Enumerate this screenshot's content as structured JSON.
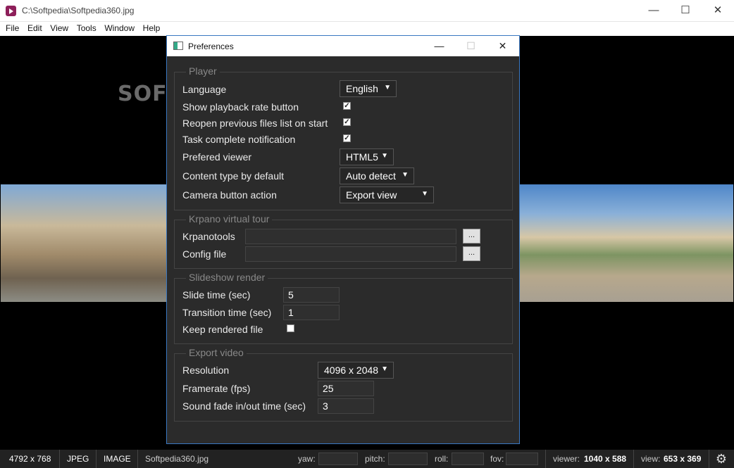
{
  "window": {
    "title": "C:\\Softpedia\\Softpedia360.jpg",
    "minimize": "—",
    "maximize": "☐",
    "close": "✕"
  },
  "menu": [
    "File",
    "Edit",
    "View",
    "Tools",
    "Window",
    "Help"
  ],
  "viewer": {
    "watermark": "SOFTPEDIA"
  },
  "status": {
    "dimensions": "4792 x 768",
    "format": "JPEG",
    "type": "IMAGE",
    "filename": "Softpedia360.jpg",
    "yaw_label": "yaw:",
    "pitch_label": "pitch:",
    "roll_label": "roll:",
    "fov_label": "fov:",
    "viewer_label": "viewer:",
    "viewer_size": "1040 x 588",
    "view_label": "view:",
    "view_size": "653 x 369"
  },
  "dialog": {
    "title": "Preferences",
    "player": {
      "legend": "Player",
      "language_label": "Language",
      "language_value": "English",
      "show_rate_label": "Show playback rate button",
      "show_rate_checked": true,
      "reopen_label": "Reopen previous files list on start",
      "reopen_checked": true,
      "task_notify_label": "Task complete notification",
      "task_notify_checked": true,
      "viewer_label": "Prefered viewer",
      "viewer_value": "HTML5",
      "content_type_label": "Content type by default",
      "content_type_value": "Auto detect",
      "camera_label": "Camera button action",
      "camera_value": "Export view"
    },
    "krpano": {
      "legend": "Krpano virtual tour",
      "tools_label": "Krpanotools",
      "tools_value": "",
      "config_label": "Config file",
      "config_value": "",
      "browse": "..."
    },
    "slideshow": {
      "legend": "Slideshow render",
      "slide_time_label": "Slide time (sec)",
      "slide_time_value": "5",
      "transition_label": "Transition time (sec)",
      "transition_value": "1",
      "keep_label": "Keep rendered file",
      "keep_checked": false
    },
    "export": {
      "legend": "Export video",
      "resolution_label": "Resolution",
      "resolution_value": "4096 x 2048",
      "framerate_label": "Framerate (fps)",
      "framerate_value": "25",
      "fade_label": "Sound fade in/out time (sec)",
      "fade_value": "3"
    }
  }
}
